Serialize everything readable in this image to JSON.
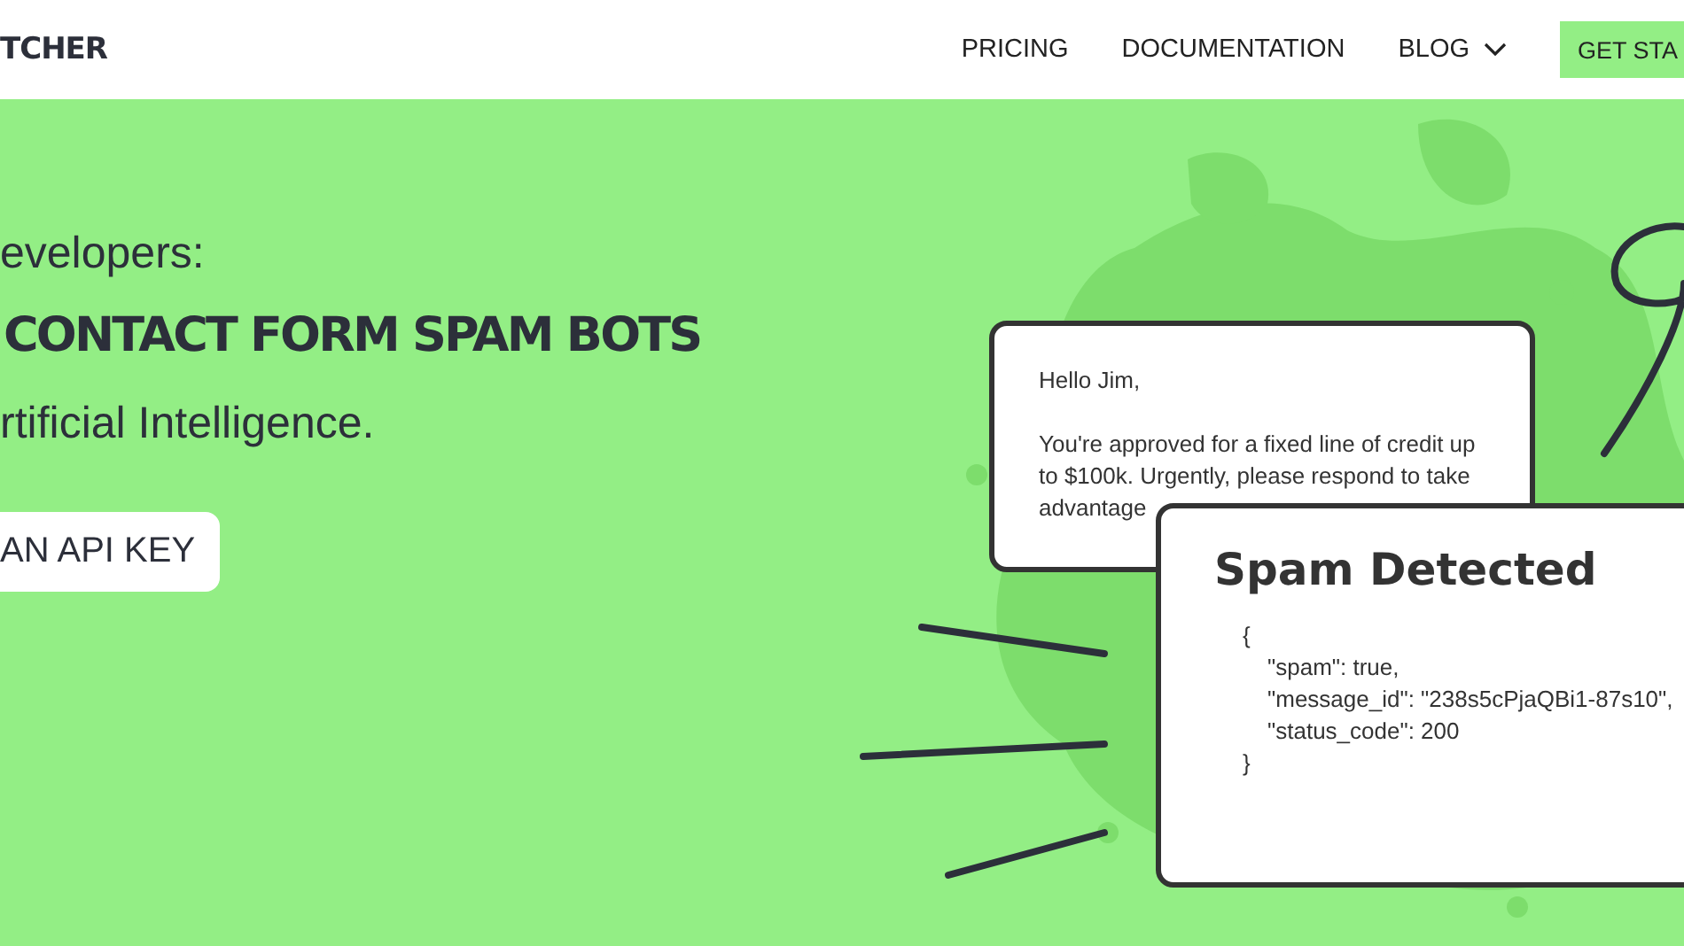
{
  "header": {
    "logo": "TCHER",
    "nav": [
      {
        "label": "PRICING",
        "kind": "link"
      },
      {
        "label": "DOCUMENTATION",
        "kind": "link"
      },
      {
        "label": "BLOG",
        "kind": "dropdown"
      }
    ],
    "cta": "GET STA"
  },
  "hero": {
    "lines": [
      {
        "text": "evelopers:",
        "kind": "subtitle"
      },
      {
        "text": "CONTACT FORM SPAM BOTS",
        "kind": "headline"
      },
      {
        "text": "rtificial Intelligence.",
        "kind": "subtitle"
      }
    ],
    "button": "AN API KEY"
  },
  "email": {
    "greeting": "Hello Jim,",
    "body_lines": [
      "You're approved for a fixed line of credit up",
      "to $100k. Urgently, please respond to take",
      "advantage"
    ]
  },
  "result": {
    "title": "Spam Detected",
    "code": [
      {
        "text": "{",
        "kind": "brace"
      },
      {
        "text": "\"spam\": true,",
        "kind": "field"
      },
      {
        "text": "\"message_id\": \"238s5cPjaQBi1-87s10\",",
        "kind": "field"
      },
      {
        "text": "\"status_code\": 200",
        "kind": "field"
      },
      {
        "text": "}",
        "kind": "brace"
      }
    ]
  }
}
